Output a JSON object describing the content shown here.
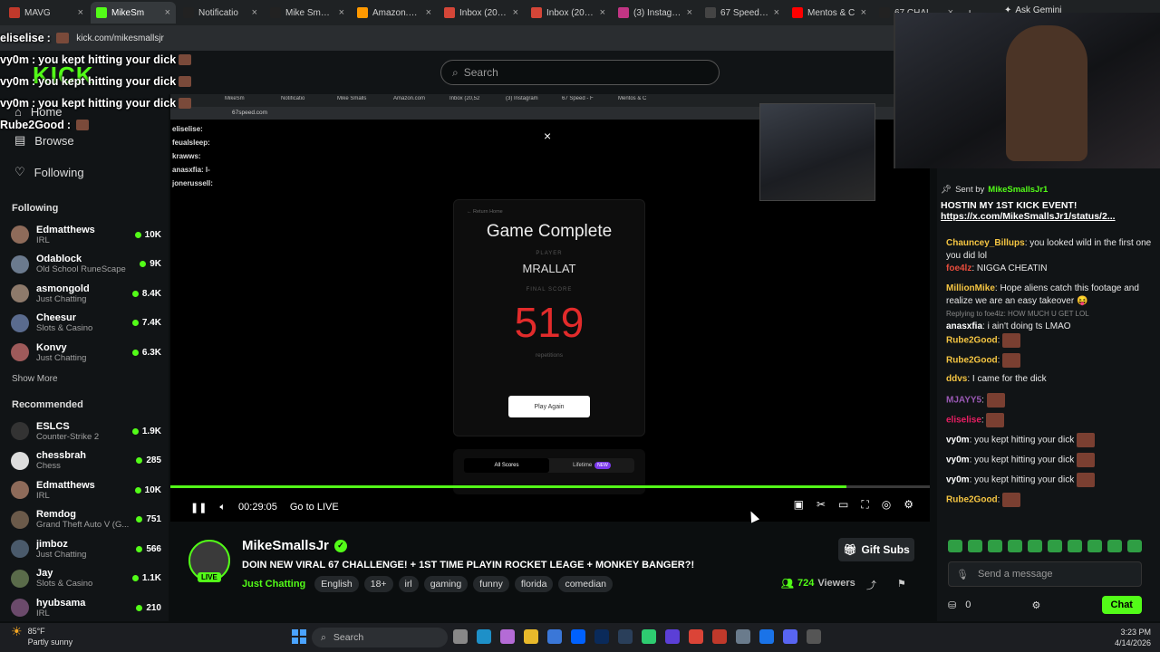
{
  "browser": {
    "tabs": [
      {
        "label": "MAVG",
        "color": "#c0392b",
        "active": false
      },
      {
        "label": "MikeSm",
        "color": "#53fc18",
        "active": true
      },
      {
        "label": "Notificatio",
        "color": "#222222",
        "active": false
      },
      {
        "label": "Mike Smalls",
        "color": "#222222",
        "active": false
      },
      {
        "label": "Amazon.com",
        "color": "#ff9900",
        "active": false
      },
      {
        "label": "Inbox (20,52",
        "color": "#d44638",
        "active": false
      },
      {
        "label": "Inbox (20,52",
        "color": "#d44638",
        "active": false
      },
      {
        "label": "(3) Instagram",
        "color": "#c13584",
        "active": false
      },
      {
        "label": "67 Speed - F",
        "color": "#444444",
        "active": false
      },
      {
        "label": "Mentos & C",
        "color": "#ff0000",
        "active": false
      },
      {
        "label": "67 CHALLEN",
        "color": "#222222",
        "active": false
      }
    ],
    "new_tab": "+",
    "gemini": "Ask Gemini",
    "url": "kick.com/mikesmallsjr"
  },
  "kick": {
    "logo": "KICK",
    "search_placeholder": "Search"
  },
  "overlay_chat": [
    {
      "user": "eliselise",
      "text": ""
    },
    {
      "user": "vy0m",
      "text": "you kept hitting your dick"
    },
    {
      "user": "vy0m",
      "text": "you kept hitting your dick"
    },
    {
      "user": "vy0m",
      "text": "you kept hitting your dick"
    },
    {
      "user": "Rube2Good",
      "text": ""
    }
  ],
  "sidebar": {
    "nav": [
      {
        "label": "Home",
        "icon": "home-icon"
      },
      {
        "label": "Browse",
        "icon": "browse-icon"
      },
      {
        "label": "Following",
        "icon": "heart-icon"
      }
    ],
    "following_heading": "Following",
    "following": [
      {
        "name": "Edmatthews",
        "category": "IRL",
        "count": "10K",
        "color": "#8e6b5a"
      },
      {
        "name": "Odablock",
        "category": "Old School RuneScape",
        "count": "9K",
        "color": "#6b7a8e"
      },
      {
        "name": "asmongold",
        "category": "Just Chatting",
        "count": "8.4K",
        "color": "#8e7a6b"
      },
      {
        "name": "Cheesur",
        "category": "Slots & Casino",
        "count": "7.4K",
        "color": "#5a6b8e"
      },
      {
        "name": "Konvy",
        "category": "Just Chatting",
        "count": "6.3K",
        "color": "#9e5a5a"
      }
    ],
    "show_more": "Show More",
    "recommended_heading": "Recommended",
    "recommended": [
      {
        "name": "ESLCS",
        "category": "Counter-Strike 2",
        "count": "1.9K",
        "color": "#333333"
      },
      {
        "name": "chessbrah",
        "category": "Chess",
        "count": "285",
        "color": "#dddddd"
      },
      {
        "name": "Edmatthews",
        "category": "IRL",
        "count": "10K",
        "color": "#8e6b5a"
      },
      {
        "name": "Remdog",
        "category": "Grand Theft Auto V (G...",
        "count": "751",
        "color": "#6b5a4a"
      },
      {
        "name": "jimboz",
        "category": "Just Chatting",
        "count": "566",
        "color": "#4a5a6b"
      },
      {
        "name": "Jay",
        "category": "Slots & Casino",
        "count": "1.1K",
        "color": "#5a6b4a"
      },
      {
        "name": "hyubsama",
        "category": "IRL",
        "count": "210",
        "color": "#6b4a6b"
      }
    ]
  },
  "stream": {
    "inner_url": "67speed.com",
    "inner_chat": [
      {
        "text": "eliselise:"
      },
      {
        "text": "feualsleep:"
      },
      {
        "text": "krawws:"
      },
      {
        "text": "anasxfia: l-"
      },
      {
        "text": "jonerussell:"
      }
    ],
    "close": "×",
    "game": {
      "return": "← Return Home",
      "title": "Game Complete",
      "player_label": "PLAYER",
      "player": "MRALLAT",
      "score_label": "FINAL SCORE",
      "score": "519",
      "unit": "repetitions",
      "button": "Play Again",
      "tab_all": "All Scores",
      "tab_lifetime": "Lifetime",
      "badge_new": "NEW"
    },
    "progress": 0.89,
    "time": "00:29:05",
    "go_live": "Go to LIVE"
  },
  "channel": {
    "name": "MikeSmallsJr",
    "live": "LIVE",
    "title": "DOIN NEW VIRAL 67 CHALLENGE! + 1ST TIME PLAYIN ROCKET LEAGE + MONKEY BANGER?!",
    "category": "Just Chatting",
    "tags": [
      "English",
      "18+",
      "irl",
      "gaming",
      "funny",
      "florida",
      "comedian"
    ],
    "viewers_count": "724",
    "viewers_label": "Viewers",
    "gift": "Gift Subs"
  },
  "chat": {
    "pinned_prefix": "Sent by",
    "pinned_sender": "MikeSmallsJr1",
    "pinned_message": "HOSTIN MY 1ST KICK EVENT!",
    "pinned_link": "https://x.com/MikeSmallsJr1/status/2...",
    "messages": [
      {
        "user": "Chauncey_Billups",
        "color": "#f5c542",
        "text": "you looked wild in the first one you did lol",
        "reply": "",
        "emote": false
      },
      {
        "user": "foe4lz",
        "color": "#e74c3c",
        "text": "NIGGA CHEATIN",
        "reply": "",
        "emote": false
      },
      {
        "user": "MillionMike",
        "color": "#f5c542",
        "text": "Hope aliens catch this footage and realize we are an easy takeover 😝",
        "reply": "",
        "emote": false
      },
      {
        "user": "anasxfia",
        "color": "#ffffff",
        "text": "i ain't doing ts LMAO",
        "reply": "Replying to foe4lz: HOW MUCH U GET LOL",
        "emote": false
      },
      {
        "user": "Rube2Good",
        "color": "#f5c542",
        "text": "",
        "reply": "",
        "emote": true
      },
      {
        "user": "Rube2Good",
        "color": "#f5c542",
        "text": "",
        "reply": "",
        "emote": true
      },
      {
        "user": "ddvs",
        "color": "#f5c542",
        "text": "I came for the dick",
        "reply": "",
        "emote": false
      },
      {
        "user": "MJAYY5",
        "color": "#9b59b6",
        "text": "",
        "reply": "",
        "emote": true
      },
      {
        "user": "eliselise",
        "color": "#e91e63",
        "text": "",
        "reply": "",
        "emote": true
      },
      {
        "user": "vy0m",
        "color": "#ffffff",
        "text": "you kept hitting your dick",
        "reply": "",
        "emote": true
      },
      {
        "user": "vy0m",
        "color": "#ffffff",
        "text": "you kept hitting your dick",
        "reply": "",
        "emote": true
      },
      {
        "user": "vy0m",
        "color": "#ffffff",
        "text": "you kept hitting your dick",
        "reply": "",
        "emote": true
      },
      {
        "user": "Rube2Good",
        "color": "#f5c542",
        "text": "",
        "reply": "",
        "emote": true
      }
    ],
    "input_placeholder": "Send a message",
    "points": "0",
    "send": "Chat"
  },
  "taskbar": {
    "temp": "85°F",
    "weather": "Partly sunny",
    "search": "Search",
    "time": "3:23 PM",
    "date": "4/14/2026"
  }
}
